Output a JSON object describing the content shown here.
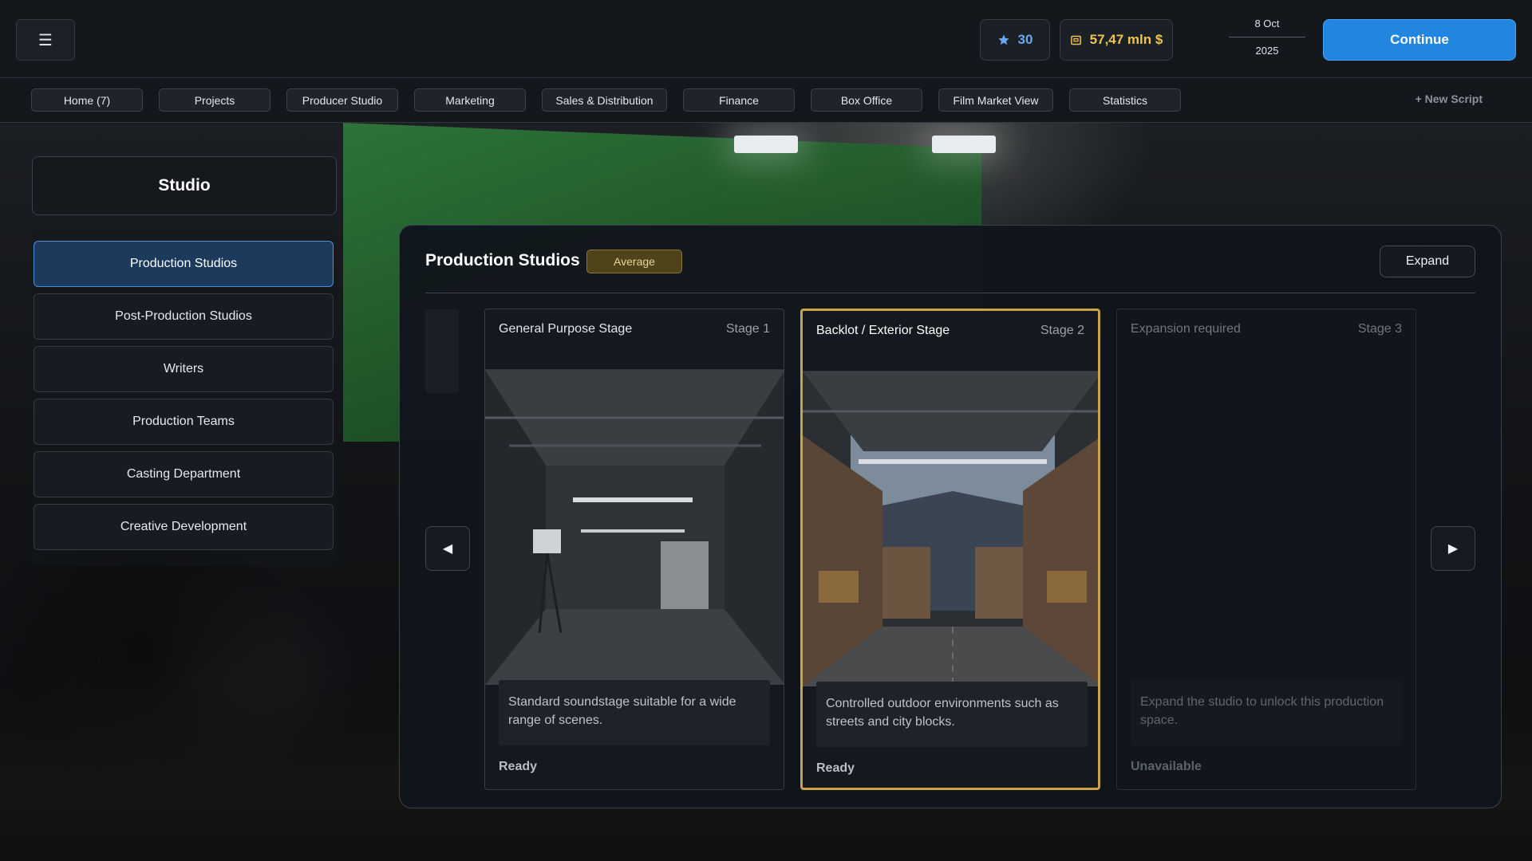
{
  "topbar": {
    "menu_icon": "☰",
    "stars_value": "30",
    "money_value": "57,47 mln $",
    "date_day": "8 Oct",
    "date_year": "2025",
    "continue_label": "Continue",
    "accent_color": "#2286e0"
  },
  "nav": {
    "tabs": [
      {
        "label": "Home (7)"
      },
      {
        "label": "Projects"
      },
      {
        "label": "Producer Studio"
      },
      {
        "label": "Marketing"
      },
      {
        "label": "Sales & Distribution"
      },
      {
        "label": "Finance"
      },
      {
        "label": "Box Office"
      },
      {
        "label": "Film Market View"
      },
      {
        "label": "Statistics"
      }
    ],
    "new_script_label": "+ New Script"
  },
  "sidebar": {
    "title": "Studio",
    "items": [
      {
        "label": "Production Studios",
        "active": true
      },
      {
        "label": "Post-Production Studios"
      },
      {
        "label": "Writers"
      },
      {
        "label": "Production Teams"
      },
      {
        "label": "Casting Department"
      },
      {
        "label": "Creative Development"
      }
    ]
  },
  "main": {
    "title": "Production Studios",
    "quality_badge": "Average",
    "expand_label": "Expand",
    "prev_icon": "◀",
    "next_icon": "▶",
    "stages": [
      {
        "name": "General Purpose Stage",
        "stage": "Stage 1",
        "description": "Standard soundstage suitable for a wide range of scenes.",
        "status": "Ready"
      },
      {
        "name": "Backlot / Exterior Stage",
        "stage": "Stage 2",
        "description": "Controlled outdoor environments such as streets and city blocks.",
        "status": "Ready",
        "selected": true
      },
      {
        "name": "Expansion required",
        "stage": "Stage 3",
        "description": "Expand the studio to unlock this production space.",
        "status": "Unavailable"
      }
    ]
  }
}
